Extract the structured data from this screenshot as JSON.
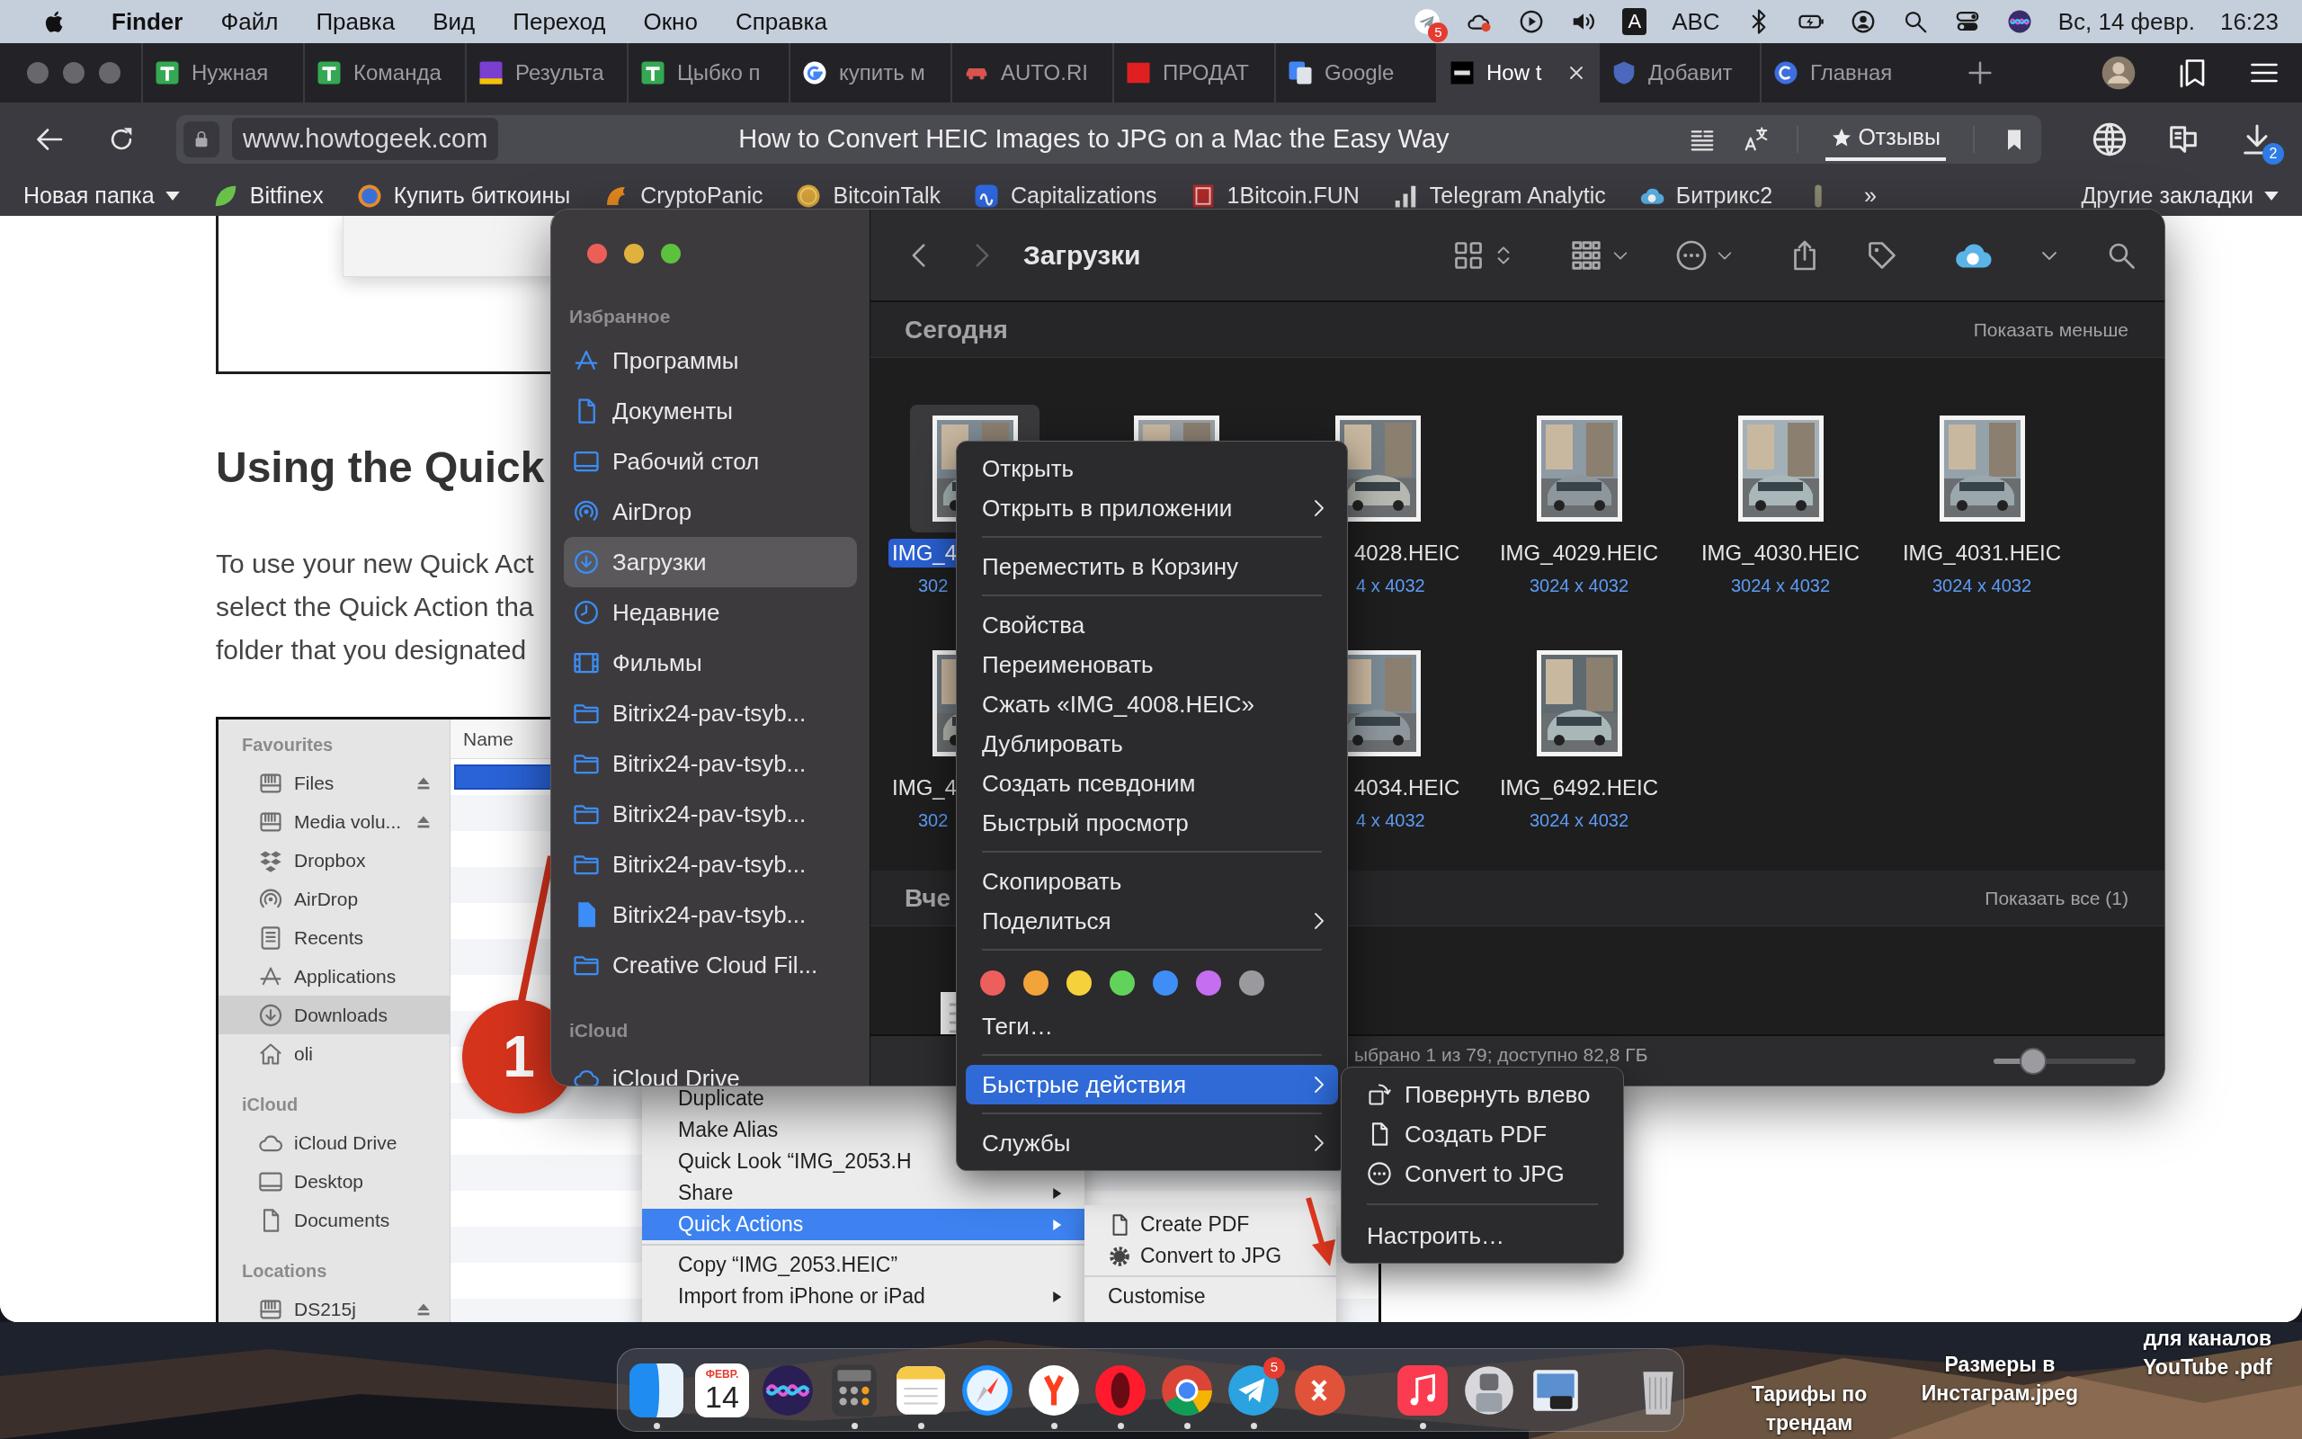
{
  "menu_bar": {
    "app_name": "Finder",
    "menus": [
      "Файл",
      "Правка",
      "Вид",
      "Переход",
      "Окно",
      "Справка"
    ],
    "telegram_badge": "5",
    "input_letter": "A",
    "input_source": "ABC",
    "date": "Вс, 14 февр.",
    "time": "16:23"
  },
  "browser": {
    "tabs": [
      {
        "label": "Нужная",
        "selected": false
      },
      {
        "label": "Команда",
        "selected": false
      },
      {
        "label": "Результа",
        "selected": false
      },
      {
        "label": "Цыбко п",
        "selected": false
      },
      {
        "label": "купить м",
        "selected": false
      },
      {
        "label": "AUTO.RI",
        "selected": false
      },
      {
        "label": "ПРОДАТ",
        "selected": false
      },
      {
        "label": "Google",
        "selected": false
      },
      {
        "label": "How t",
        "selected": true
      },
      {
        "label": "Добавит",
        "selected": false
      },
      {
        "label": "Главная",
        "selected": false
      }
    ],
    "address": "www.howtogeek.com",
    "page_title": "How to Convert HEIC Images to JPG on a Mac the Easy Way",
    "reviews_label": "Отзывы",
    "downloads_badge": "2",
    "bookmarks": [
      {
        "kind": "folder",
        "label": "Новая папка"
      },
      {
        "kind": "link",
        "label": "Bitfinex"
      },
      {
        "kind": "link",
        "label": "Купить биткоины"
      },
      {
        "kind": "link",
        "label": "CryptoPanic"
      },
      {
        "kind": "link",
        "label": "BitcoinTalk"
      },
      {
        "kind": "link",
        "label": "Capitalizations"
      },
      {
        "kind": "link",
        "label": "1Bitcoin.FUN"
      },
      {
        "kind": "link",
        "label": "Telegram Analytic"
      },
      {
        "kind": "link",
        "label": "Битрикс2"
      }
    ],
    "overflow": "»",
    "other_bookmarks": "Другие закладки"
  },
  "article": {
    "heading": "Using the Quick",
    "paragraph_lines": [
      "To use your new Quick Act",
      "select the Quick Action tha",
      "folder that you designated"
    ],
    "screenshot": {
      "sidebar": [
        {
          "kind": "header",
          "label": "Favourites"
        },
        {
          "kind": "item",
          "label": "Files",
          "eject": true,
          "selected": false
        },
        {
          "kind": "item",
          "label": "Media volu...",
          "eject": true,
          "selected": false
        },
        {
          "kind": "item",
          "label": "Dropbox",
          "eject": false,
          "selected": false
        },
        {
          "kind": "item",
          "label": "AirDrop",
          "eject": false,
          "selected": false
        },
        {
          "kind": "item",
          "label": "Recents",
          "eject": false,
          "selected": false
        },
        {
          "kind": "item",
          "label": "Applications",
          "eject": false,
          "selected": false
        },
        {
          "kind": "item",
          "label": "Downloads",
          "eject": false,
          "selected": true
        },
        {
          "kind": "item",
          "label": "oli",
          "eject": false,
          "selected": false
        },
        {
          "kind": "header",
          "label": "iCloud"
        },
        {
          "kind": "item",
          "label": "iCloud Drive",
          "eject": false,
          "selected": false
        },
        {
          "kind": "item",
          "label": "Desktop",
          "eject": false,
          "selected": false
        },
        {
          "kind": "item",
          "label": "Documents",
          "eject": false,
          "selected": false
        },
        {
          "kind": "header",
          "label": "Locations"
        },
        {
          "kind": "item",
          "label": "DS215j",
          "eject": true,
          "selected": false
        }
      ],
      "column_header": "Name",
      "callout": "1",
      "menu": [
        {
          "kind": "item",
          "label": "Duplicate",
          "has_submenu": false,
          "selected": false
        },
        {
          "kind": "item",
          "label": "Make Alias",
          "has_submenu": false,
          "selected": false
        },
        {
          "kind": "item",
          "label": "Quick Look “IMG_2053.H",
          "has_submenu": false,
          "selected": false
        },
        {
          "kind": "item",
          "label": "Share",
          "has_submenu": true,
          "selected": false
        },
        {
          "kind": "item",
          "label": "Quick Actions",
          "has_submenu": true,
          "selected": true
        },
        {
          "kind": "separator"
        },
        {
          "kind": "item",
          "label": "Copy “IMG_2053.HEIC”",
          "has_submenu": false,
          "selected": false
        },
        {
          "kind": "item",
          "label": "Import from iPhone or iPad",
          "has_submenu": true,
          "selected": false
        }
      ],
      "submenu": [
        {
          "kind": "item",
          "label": "Create PDF"
        },
        {
          "kind": "item",
          "label": "Convert to JPG"
        },
        {
          "kind": "separator"
        },
        {
          "kind": "item",
          "label": "Customise"
        }
      ]
    }
  },
  "finder": {
    "sidebar": [
      {
        "kind": "header",
        "label": "Избранное"
      },
      {
        "kind": "item",
        "label": "Программы",
        "selected": false
      },
      {
        "kind": "item",
        "label": "Документы",
        "selected": false
      },
      {
        "kind": "item",
        "label": "Рабочий стол",
        "selected": false
      },
      {
        "kind": "item",
        "label": "AirDrop",
        "selected": false
      },
      {
        "kind": "item",
        "label": "Загрузки",
        "selected": true
      },
      {
        "kind": "item",
        "label": "Недавние",
        "selected": false
      },
      {
        "kind": "item",
        "label": "Фильмы",
        "selected": false
      },
      {
        "kind": "item",
        "label": "Bitrix24-pav-tsyb...",
        "selected": false
      },
      {
        "kind": "item",
        "label": "Bitrix24-pav-tsyb...",
        "selected": false
      },
      {
        "kind": "item",
        "label": "Bitrix24-pav-tsyb...",
        "selected": false
      },
      {
        "kind": "item",
        "label": "Bitrix24-pav-tsyb...",
        "selected": false
      },
      {
        "kind": "item",
        "label": "Bitrix24-pav-tsyb...",
        "selected": false
      },
      {
        "kind": "item",
        "label": "Creative Cloud Fil...",
        "selected": false
      },
      {
        "kind": "header",
        "label": "iCloud"
      },
      {
        "kind": "item",
        "label": "iCloud Drive",
        "selected": false
      }
    ],
    "title": "Загрузки",
    "sections": [
      {
        "title": "Сегодня",
        "action": "Показать меньше",
        "rows": [
          [
            {
              "kind": "picture",
              "name": "IMG_4",
              "dims": "302",
              "selected": true
            },
            {
              "kind": "picture",
              "selected": false
            },
            {
              "kind": "picture",
              "name": "4028.HEIC",
              "dims": "4 x 4032",
              "selected": false
            },
            {
              "kind": "picture",
              "name": "IMG_4029.HEIC",
              "dims": "3024 x 4032",
              "selected": false
            },
            {
              "kind": "picture",
              "name": "IMG_4030.HEIC",
              "dims": "3024 x 4032",
              "selected": false
            },
            {
              "kind": "picture",
              "name": "IMG_4031.HEIC",
              "dims": "3024 x 4032",
              "selected": false
            }
          ],
          [
            {
              "kind": "picture",
              "name": "IMG_4",
              "dims": "302",
              "selected": false
            },
            null,
            {
              "kind": "picture",
              "name": "4034.HEIC",
              "dims": "4 x 4032",
              "selected": false
            },
            {
              "kind": "picture",
              "name": "IMG_6492.HEIC",
              "dims": "3024 x 4032",
              "selected": false
            }
          ]
        ]
      },
      {
        "title": "Вче",
        "action": "Показать все (1)",
        "rows": [
          [
            {
              "kind": "document",
              "selected": false
            }
          ]
        ]
      }
    ],
    "status": "ыбрано 1 из 79; доступно 82,8 ГБ",
    "zoom": {
      "level": 0.28
    }
  },
  "context_menu": [
    {
      "kind": "item",
      "label": "Открыть",
      "has_submenu": false,
      "selected": false
    },
    {
      "kind": "item",
      "label": "Открыть в приложении",
      "has_submenu": true,
      "selected": false
    },
    {
      "kind": "separator"
    },
    {
      "kind": "item",
      "label": "Переместить в Корзину",
      "has_submenu": false,
      "selected": false
    },
    {
      "kind": "separator"
    },
    {
      "kind": "item",
      "label": "Свойства",
      "has_submenu": false,
      "selected": false
    },
    {
      "kind": "item",
      "label": "Переименовать",
      "has_submenu": false,
      "selected": false
    },
    {
      "kind": "item",
      "label": "Сжать «IMG_4008.HEIC»",
      "has_submenu": false,
      "selected": false
    },
    {
      "kind": "item",
      "label": "Дублировать",
      "has_submenu": false,
      "selected": false
    },
    {
      "kind": "item",
      "label": "Создать псевдоним",
      "has_submenu": false,
      "selected": false
    },
    {
      "kind": "item",
      "label": "Быстрый просмотр",
      "has_submenu": false,
      "selected": false
    },
    {
      "kind": "separator"
    },
    {
      "kind": "item",
      "label": "Скопировать",
      "has_submenu": false,
      "selected": false
    },
    {
      "kind": "item",
      "label": "Поделиться",
      "has_submenu": true,
      "selected": false
    },
    {
      "kind": "separator"
    },
    {
      "kind": "tags",
      "tags": [
        {
          "color": "#ec5f5d"
        },
        {
          "color": "#f2a33a"
        },
        {
          "color": "#f5d13b"
        },
        {
          "color": "#62d35a"
        },
        {
          "color": "#3f8ef5"
        },
        {
          "color": "#c56ef0"
        },
        {
          "color": "#9a9a9e"
        }
      ]
    },
    {
      "kind": "item",
      "label": "Теги…",
      "has_submenu": false,
      "selected": false
    },
    {
      "kind": "separator"
    },
    {
      "kind": "item",
      "label": "Быстрые действия",
      "has_submenu": true,
      "selected": true
    },
    {
      "kind": "separator"
    },
    {
      "kind": "item",
      "label": "Службы",
      "has_submenu": true,
      "selected": false
    }
  ],
  "submenu": [
    {
      "kind": "item",
      "label": "Повернуть влево"
    },
    {
      "kind": "item",
      "label": "Создать PDF"
    },
    {
      "kind": "item",
      "label": "Convert to JPG"
    },
    {
      "kind": "separator"
    },
    {
      "kind": "item",
      "label": "Настроить…"
    }
  ],
  "dock": {
    "groups": [
      [
        {
          "running": true
        },
        {
          "running": false,
          "month": "ФЕВР.",
          "day": "14"
        },
        {
          "running": false
        },
        {
          "running": true
        },
        {
          "running": true
        },
        {
          "running": false
        },
        {
          "running": true
        },
        {
          "running": true
        },
        {
          "running": true
        },
        {
          "running": true,
          "badge": "5"
        },
        {
          "running": false
        }
      ],
      [
        {
          "running": true
        },
        {
          "running": false
        },
        {
          "running": false
        }
      ],
      [
        {
          "running": false
        }
      ]
    ]
  },
  "desktop_files": [
    {
      "lines": [
        "для каналов",
        "YouTube .pdf"
      ]
    },
    {
      "lines": [
        "Размеры в",
        "Инстаграм.jpeg"
      ]
    },
    {
      "lines": [
        "Тарифы по",
        "трендам"
      ]
    }
  ]
}
